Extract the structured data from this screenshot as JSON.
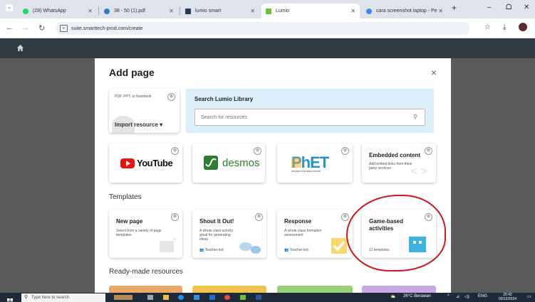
{
  "browser": {
    "tabs": [
      {
        "title": "(28) WhatsApp"
      },
      {
        "title": "38 - 50 (1).pdf"
      },
      {
        "title": "lumio smart"
      },
      {
        "title": "Lumio"
      },
      {
        "title": "cara screenshot laptop - Pe"
      }
    ],
    "new_tab": "+",
    "minimize": "–",
    "maximize": "ᗝ",
    "window_close": "✕",
    "url": "suite.smarttech-prod.com/create"
  },
  "dialog": {
    "title": "Add page",
    "close": "×",
    "import_card": {
      "formats": "PDF, PPT, or Notebook",
      "label": "Import resource ▾"
    },
    "search": {
      "title": "Search Lumio Library",
      "placeholder": "Search for resources"
    },
    "resources": [
      {
        "name": "YouTube"
      },
      {
        "name": "desmos"
      },
      {
        "name": "PhET",
        "sub": "INTERACTIVE SIMULATIONS"
      },
      {
        "name": "Embedded content",
        "desc": "Add embed links from third-party services"
      }
    ],
    "templates_heading": "Templates",
    "templates": [
      {
        "title": "New page",
        "desc": "Select from a variety of page templates",
        "footer": ""
      },
      {
        "title": "Shout It Out!",
        "desc": "A whole class activity great for generating ideas",
        "footer": "Teacher-led"
      },
      {
        "title": "Response",
        "desc": "A whole class formative assessment",
        "footer": "Teacher-led"
      },
      {
        "title": "Game-based activities",
        "desc": "",
        "footer": "12 templates"
      }
    ],
    "ready_heading": "Ready-made resources"
  },
  "taskbar": {
    "search_placeholder": "Type here to search",
    "weather": "26°C Berawan",
    "language": "ENG",
    "time": "20:42",
    "date": "03/12/2024"
  },
  "colors": {
    "accent": "#d1161b",
    "header": "#2f3a42",
    "search_panel": "#dbeef9"
  }
}
